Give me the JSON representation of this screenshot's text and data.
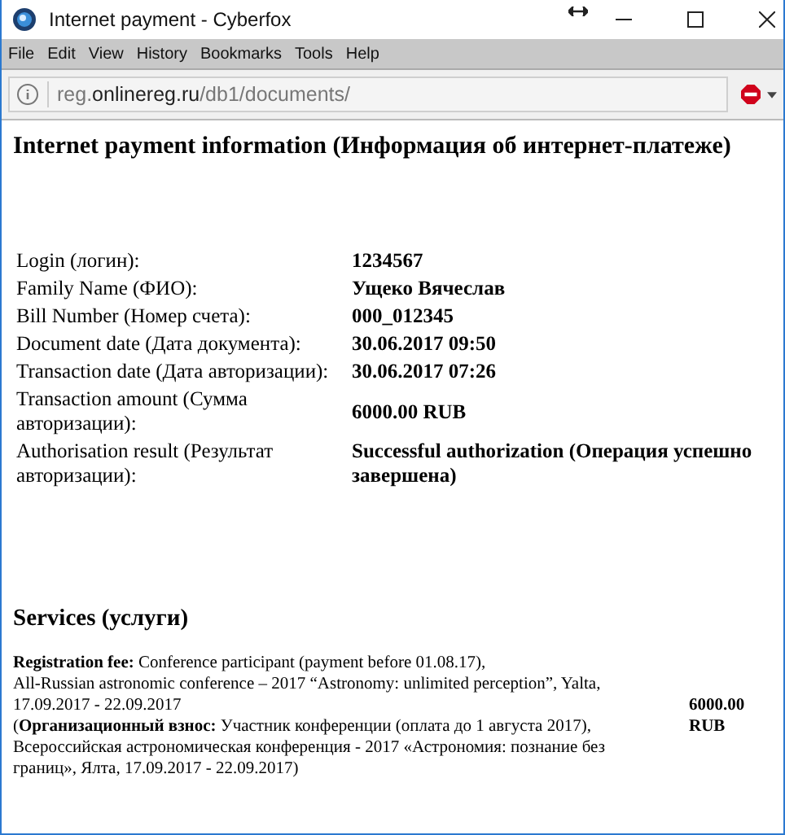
{
  "window": {
    "title": "Internet payment - Cyberfox"
  },
  "menu": [
    "File",
    "Edit",
    "View",
    "History",
    "Bookmarks",
    "Tools",
    "Help"
  ],
  "address": {
    "host_prefix": "reg.",
    "host": "onlinereg.ru",
    "path": "/db1/documents/"
  },
  "heading": "Internet payment information (Информация об интернет-платеже)",
  "fields": [
    {
      "label": "Login (логин):",
      "value": "1234567"
    },
    {
      "label": "Family Name (ФИО):",
      "value": "Ущеко Вячеслав"
    },
    {
      "label": "Bill Number (Номер счета):",
      "value": "000_012345"
    },
    {
      "label": "Document date (Дата документа):",
      "value": "30.06.2017 09:50"
    },
    {
      "label": "Transaction date (Дата авторизации):",
      "value": "30.06.2017 07:26"
    },
    {
      "label": "Transaction amount (Сумма авторизации):",
      "value": "6000.00 RUB"
    },
    {
      "label": "Authorisation result (Результат авторизации):",
      "value": "Successful authorization (Операция успешно завершена)"
    }
  ],
  "services": {
    "heading": "Services (услуги)",
    "items": [
      {
        "description": "**Registration fee:** Conference participant (payment before 01.08.17),\nAll-Russian astronomic conference – 2017 “Astronomy: unlimited perception”, Yalta,\n17.09.2017 - 22.09.2017\n(**Организационный взнос:** Участник конференции (оплата до 1 августа 2017),\nВсероссийская астрономическая конференция - 2017 «Астрономия: познание без\nграниц», Ялта, 17.09.2017 - 22.09.2017)",
        "price": "6000.00 RUB"
      }
    ]
  }
}
